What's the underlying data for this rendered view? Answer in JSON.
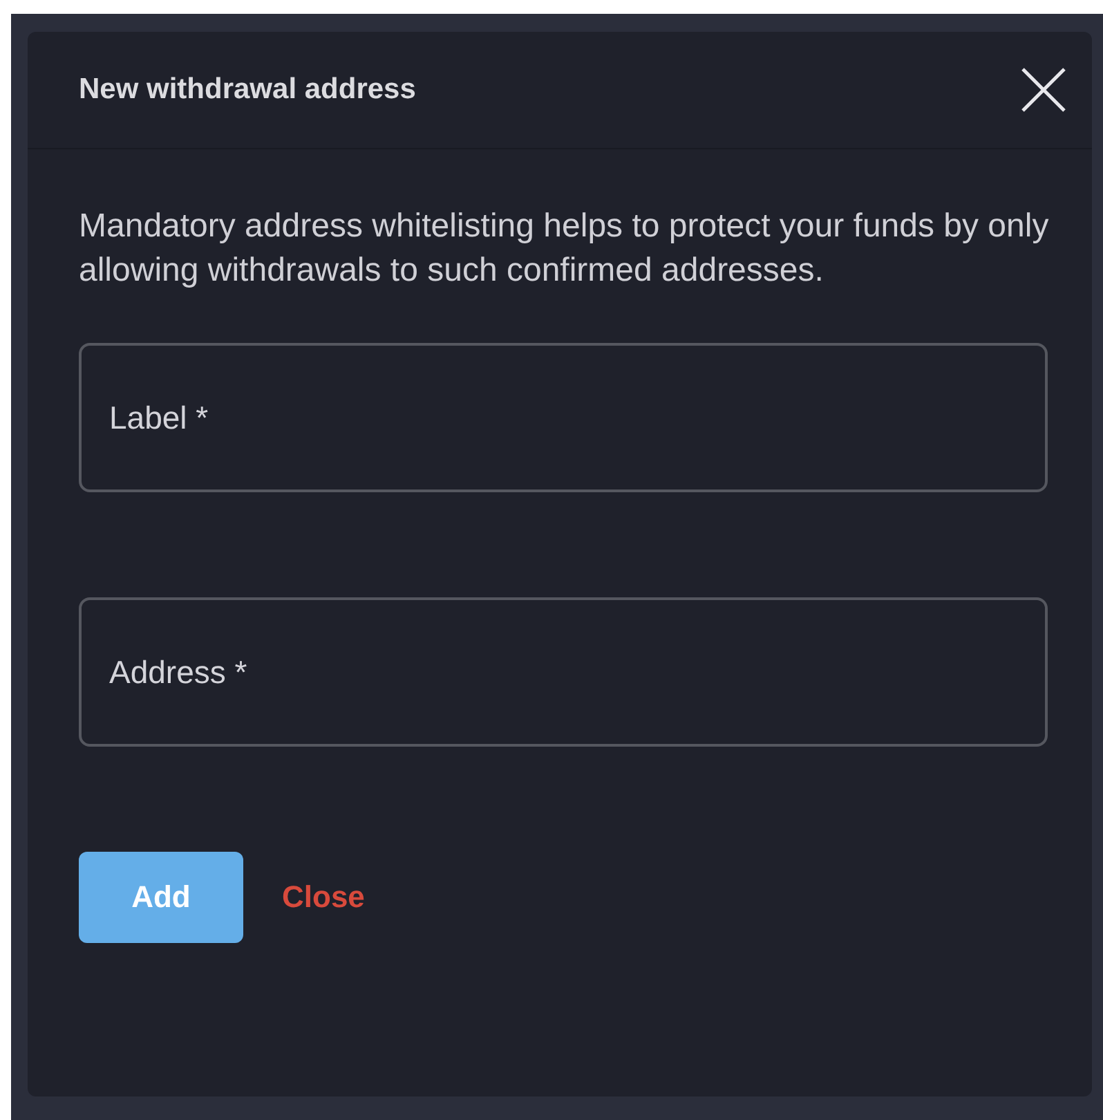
{
  "dialog": {
    "title": "New withdrawal address",
    "description": "Mandatory address whitelisting helps to protect your funds by only allowing withdrawals to such confirmed addresses.",
    "fields": [
      {
        "placeholder": "Label *"
      },
      {
        "placeholder": "Address *"
      }
    ],
    "buttons": [
      {
        "label": "Add",
        "kind": "primary"
      },
      {
        "label": "Close",
        "kind": "danger-link"
      }
    ]
  }
}
